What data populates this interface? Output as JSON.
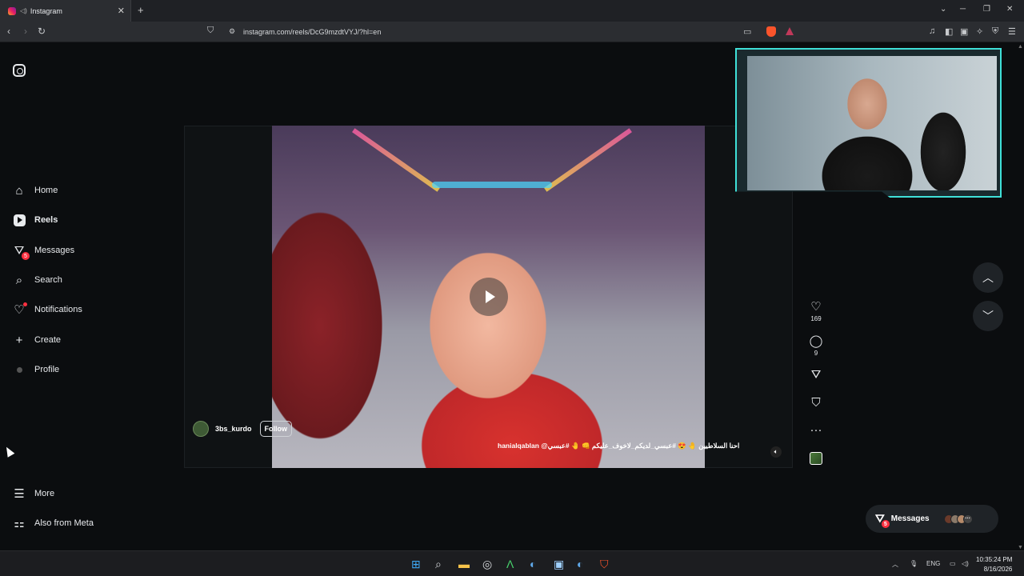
{
  "browser": {
    "tab_title": "Instagram",
    "new_tab": "+",
    "url": "instagram.com/reels/DcG9mzdtVYJ/?hl=en"
  },
  "sidebar": {
    "items": [
      {
        "label": "Home",
        "icon": "home-icon"
      },
      {
        "label": "Reels",
        "icon": "reels-icon"
      },
      {
        "label": "Messages",
        "icon": "messages-icon",
        "badge": "5"
      },
      {
        "label": "Search",
        "icon": "search-icon"
      },
      {
        "label": "Notifications",
        "icon": "heart-icon"
      },
      {
        "label": "Create",
        "icon": "plus-icon"
      },
      {
        "label": "Profile",
        "icon": "avatar"
      }
    ],
    "more": "More",
    "meta": "Also from Meta"
  },
  "reel": {
    "username": "3bs_kurdo",
    "follow_label": "Follow",
    "caption": "احنا السلاطيين 🤚 😍 #عبسي_لديكم_لاخوف_عليكم 👊 🤚 #عبسي@ hanialqablan",
    "likes": "169",
    "comments": "9"
  },
  "messages_pill": {
    "label": "Messages",
    "badge": "5"
  },
  "taskbar": {
    "lang": "ENG",
    "time": "10:35:24 PM",
    "date": "8/16/2026"
  },
  "colors": {
    "accent_badge": "#ff3040",
    "webcam_border": "#3fe0d8",
    "background": "#0b0d0f"
  }
}
